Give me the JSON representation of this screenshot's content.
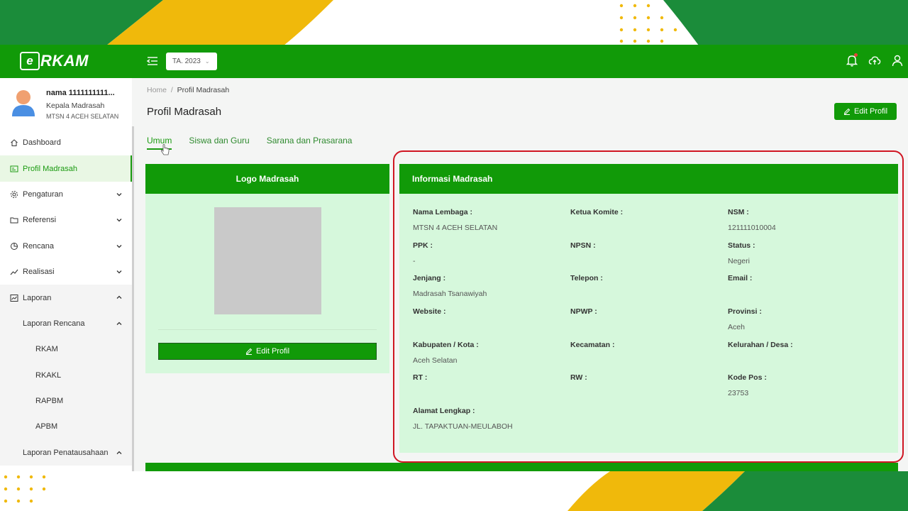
{
  "app": {
    "logo_letter": "e",
    "logo_text": "RKAM",
    "year_select": "TA. 2023"
  },
  "user": {
    "name": "nama 1111111111...",
    "role": "Kepala Madrasah",
    "school": "MTSN 4 ACEH SELATAN"
  },
  "sidebar": {
    "items": [
      {
        "label": "Dashboard",
        "icon": "home-icon"
      },
      {
        "label": "Profil Madrasah",
        "icon": "profile-icon",
        "active": true
      },
      {
        "label": "Pengaturan",
        "icon": "gear-icon"
      },
      {
        "label": "Referensi",
        "icon": "folder-icon"
      },
      {
        "label": "Rencana",
        "icon": "pie-icon"
      },
      {
        "label": "Realisasi",
        "icon": "trend-icon"
      },
      {
        "label": "Laporan",
        "icon": "report-icon"
      }
    ],
    "laporan_rencana": "Laporan Rencana",
    "laporan_rencana_items": [
      "RKAM",
      "RKAKL",
      "RAPBM",
      "APBM"
    ],
    "laporan_penatausahaan": "Laporan Penatausahaan"
  },
  "breadcrumb": {
    "home": "Home",
    "sep": "/",
    "current": "Profil Madrasah"
  },
  "page": {
    "title": "Profil Madrasah",
    "edit_button": "Edit Profil"
  },
  "tabs": [
    "Umum",
    "Siswa dan Guru",
    "Sarana dan Prasarana"
  ],
  "logo_card": {
    "title": "Logo Madrasah",
    "edit_button": "Edit Profil"
  },
  "info_card": {
    "title": "Informasi Madrasah",
    "fields": [
      {
        "label": "Nama Lembaga :",
        "value": "MTSN 4 ACEH SELATAN"
      },
      {
        "label": "Ketua Komite :",
        "value": ""
      },
      {
        "label": "NSM :",
        "value": "121111010004"
      },
      {
        "label": "PPK :",
        "value": "-"
      },
      {
        "label": "NPSN :",
        "value": ""
      },
      {
        "label": "Status :",
        "value": "Negeri"
      },
      {
        "label": "Jenjang :",
        "value": "Madrasah Tsanawiyah"
      },
      {
        "label": "Telepon :",
        "value": ""
      },
      {
        "label": "Email :",
        "value": ""
      },
      {
        "label": "Website :",
        "value": ""
      },
      {
        "label": "NPWP :",
        "value": ""
      },
      {
        "label": "Provinsi :",
        "value": "Aceh"
      },
      {
        "label": "Kabupaten / Kota :",
        "value": "Aceh Selatan"
      },
      {
        "label": "Kecamatan :",
        "value": ""
      },
      {
        "label": "Kelurahan / Desa :",
        "value": ""
      },
      {
        "label": "RT :",
        "value": ""
      },
      {
        "label": "RW :",
        "value": ""
      },
      {
        "label": "Kode Pos :",
        "value": "23753"
      },
      {
        "label": "Alamat Lengkap :",
        "value": "JL. TAPAKTUAN-MEULABOH"
      }
    ]
  },
  "colors": {
    "primary": "#119a08",
    "card_bg": "#d6f8dc",
    "highlight": "#d01623",
    "accent_yellow": "#f0b90b"
  }
}
